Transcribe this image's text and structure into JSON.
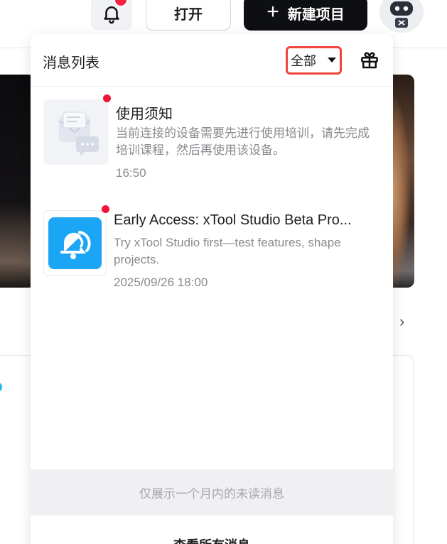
{
  "topbar": {
    "notification_icon": "bell-icon",
    "open_label": "打开",
    "new_project_icon": "plus-icon",
    "new_project_label": "新建项目",
    "avatar_icon": "robot-avatar-icon"
  },
  "panel": {
    "title": "消息列表",
    "filter_value": "全部",
    "gift_icon": "gift-icon",
    "messages": [
      {
        "title": "使用须知",
        "body": "当前连接的设备需要先进行使用培训，请先完成培训课程，然后再使用该设备。",
        "time": "16:50",
        "thumbnail_icon": "envelope-chat-icon",
        "unread": true
      },
      {
        "title": "Early Access: xTool Studio Beta Pro...",
        "body": "Try xTool Studio first—test features, shape projects.",
        "time": "2025/09/26 18:00",
        "thumbnail_icon": "bell-app-icon",
        "unread": true
      }
    ],
    "notice": "仅展示一个月内的未读消息",
    "view_all_label": "查看所有消息"
  },
  "colors": {
    "accent_red": "#f0453d",
    "unread_dot": "#f1153a",
    "primary_dark": "#0e0f12",
    "bell_app_blue": "#1aa6f5"
  }
}
